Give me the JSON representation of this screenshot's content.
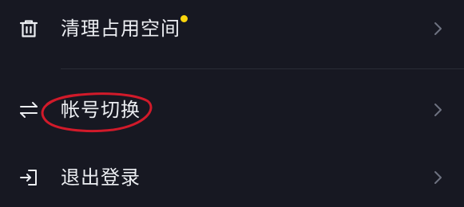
{
  "menu": {
    "items": [
      {
        "label": "清理占用空间",
        "icon": "trash-icon",
        "has_dot": true
      },
      {
        "label": "帐号切换",
        "icon": "switch-arrows-icon",
        "has_dot": false
      },
      {
        "label": "退出登录",
        "icon": "logout-icon",
        "has_dot": false
      }
    ]
  },
  "colors": {
    "background": "#171822",
    "text": "#eceef2",
    "chevron": "#6e7180",
    "divider": "#2a2c36",
    "notification_dot": "#fbd50c",
    "annotation_circle": "#d11a2a"
  }
}
